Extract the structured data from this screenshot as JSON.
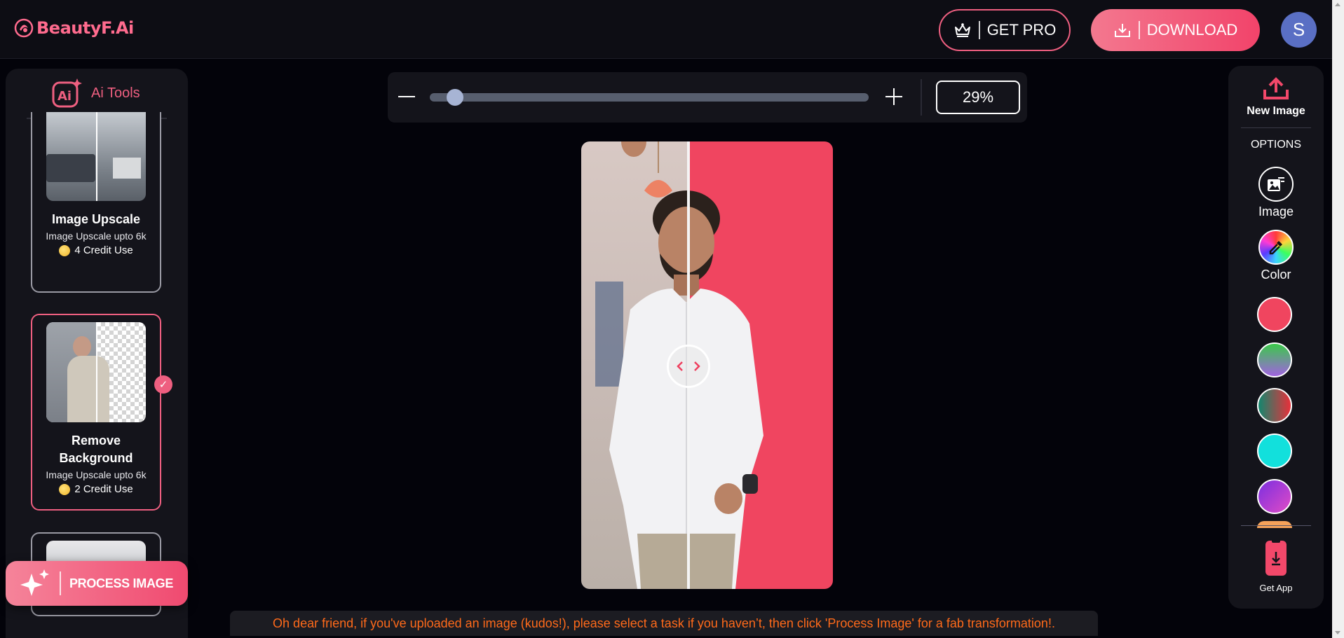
{
  "header": {
    "logo_text": "BeautyF.Ai",
    "get_pro_label": "GET PRO",
    "download_label": "DOWNLOAD",
    "avatar_initial": "S"
  },
  "left_panel": {
    "title": "Ai Tools",
    "tools": [
      {
        "title": "Image Upscale",
        "subtitle": "Image Upscale upto 6k",
        "credit": "4 Credit Use",
        "selected": false
      },
      {
        "title": "Remove Background",
        "subtitle": "Image Upscale upto 6k",
        "credit": "2 Credit Use",
        "selected": true
      }
    ],
    "process_button_label": "PROCESS IMAGE"
  },
  "zoom": {
    "value_label": "29%",
    "value_fraction": 0.04
  },
  "right_panel": {
    "new_image_label": "New Image",
    "options_title": "OPTIONS",
    "image_option_label": "Image",
    "color_option_label": "Color",
    "get_app_label": "Get App",
    "swatches": [
      {
        "name": "red",
        "color": "#f0455f"
      },
      {
        "name": "green-purple",
        "color": "linear-gradient(180deg,#3bc94a,#a063e0)"
      },
      {
        "name": "teal-red",
        "color": "linear-gradient(90deg,#13876e,#e8303a)"
      },
      {
        "name": "cyan",
        "color": "#12e0dc"
      },
      {
        "name": "purple",
        "color": "linear-gradient(135deg,#7b2fe0,#e04bc6)"
      }
    ]
  },
  "message": "Oh dear friend, if you've uploaded an image (kudos!), please select a task if you haven’t, then click 'Process Image' for a fab transformation!.",
  "colors": {
    "accent": "#ee5f80",
    "background": "#03030a",
    "panel": "#14141b",
    "message_text": "#ff6a1a",
    "removed_bg_color": "#f04560"
  }
}
